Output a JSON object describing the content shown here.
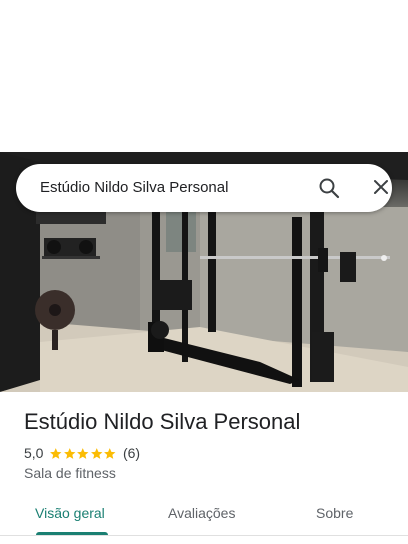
{
  "search": {
    "query": "Estúdio Nildo Silva Personal",
    "search_icon": "search-icon",
    "close_icon": "close-icon"
  },
  "photo": {
    "description_icon": "place-photo"
  },
  "place": {
    "name": "Estúdio Nildo Silva Personal",
    "rating": "5,0",
    "stars": 5,
    "review_count": "(6)",
    "category": "Sala de fitness"
  },
  "tabs": [
    {
      "label": "Visão geral",
      "active": true
    },
    {
      "label": "Avaliações",
      "active": false
    },
    {
      "label": "Sobre",
      "active": false
    }
  ],
  "colors": {
    "accent": "#1a7f72",
    "star": "#fbbc04",
    "text_primary": "#202124",
    "text_secondary": "#5f6368"
  }
}
